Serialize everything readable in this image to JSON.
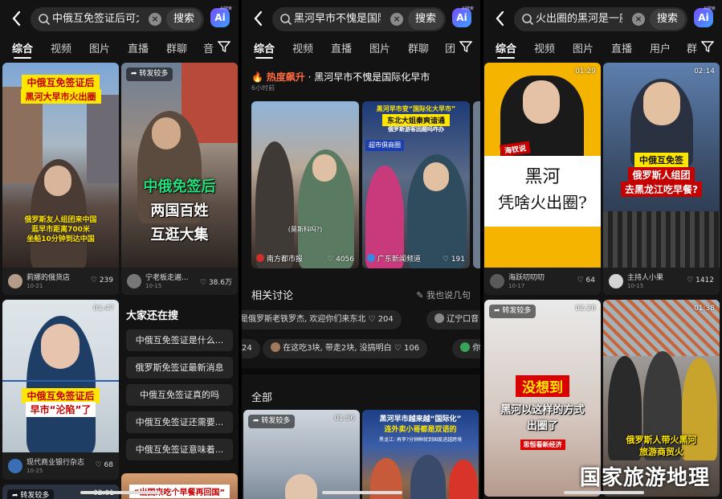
{
  "panels": [
    {
      "query": "中俄互免签证后可太扌",
      "search_label": "搜索",
      "ai_label": "Ai",
      "ai_tag": "AI搜索",
      "tabs": [
        "综合",
        "视频",
        "图片",
        "直播",
        "群聊",
        "音"
      ],
      "cards": [
        {
          "cap1": "中俄互免签证后",
          "cap2": "黑河大早市火出圈",
          "sub": "俄罗斯友人组团来中国\n逛早市距离700米\n坐船10分钟到达中国",
          "author": "莉娜的俄货店",
          "date": "10-21",
          "likes": "239"
        },
        {
          "badge": "转发较多",
          "cap1": "中俄免签后",
          "cap2": "两国百姓",
          "cap3": "互逛大集",
          "author": "宁老板走遍...",
          "date": "10-15",
          "likes": "38.6万"
        },
        {
          "duration": "01:47",
          "cap1": "中俄互免签证后",
          "cap2": "早市“沦陷”了",
          "author": "现代商业银行杂志",
          "date": "10-25",
          "likes": "68"
        },
        {
          "badge": "转发较多",
          "duration": "02:01",
          "cap1": "“出国来吃个早餐再回国”"
        }
      ],
      "also_title": "大家还在搜",
      "suggestions": [
        "中俄互免签证是什么...",
        "俄罗斯免签证最新消息",
        "中俄互免签证真的吗",
        "中俄互免签证还需要...",
        "中俄互免签证意味着..."
      ]
    },
    {
      "query": "黑河早市不愧是国际化",
      "search_label": "搜索",
      "ai_label": "Ai",
      "ai_tag": "AI搜索",
      "tabs": [
        "综合",
        "视频",
        "直播",
        "图片",
        "群聊",
        "团"
      ],
      "hot_label": "热度飙升",
      "hot_title": "· 黑河早市不愧是国际化早市",
      "hot_time": "6小时前",
      "hot_cards": [
        {
          "sub": "(莫斯科吗?)",
          "author": "南方都市报",
          "likes": "4056"
        },
        {
          "cap1": "黑河早市变“国际化大早市”",
          "cap2": "东北大姐秦爽谙通",
          "cap3": "俄罗斯游客因题吗咋办",
          "sign": "超市俱商圈",
          "author": "广东新闻频道",
          "likes": "191"
        }
      ],
      "related_title": "相关讨论",
      "related_right": "我也说几句",
      "chips_row1": [
        {
          "text": "是俄罗斯老铁罗杰, 欢迎你们来东北",
          "likes": "204"
        },
        {
          "text": "辽宁口音"
        }
      ],
      "chips_row2": [
        {
          "text": "24"
        },
        {
          "text": "在这吃3块, 带走2块, 没搞明白",
          "likes": "106"
        },
        {
          "text": "你"
        }
      ],
      "all_title": "全部",
      "bottom_cards": [
        {
          "badge": "转发较多",
          "duration": "01:56"
        },
        {
          "cap1": "黑河早市越来越“国际化”",
          "cap2": "连外卖小哥都是双语的",
          "cap3": "黑龙江: 再李?分钟鲜就到国度进越跨境"
        }
      ]
    },
    {
      "query": "火出圈的黑河是一座",
      "search_label": "搜索",
      "ai_label": "Ai",
      "ai_tag": "AI搜索",
      "tabs": [
        "综合",
        "视频",
        "图片",
        "直播",
        "用户",
        "群"
      ],
      "cards": [
        {
          "duration": "01:29",
          "tag": "海钗说",
          "cap1": "黑河",
          "cap2": "凭啥火出圈?",
          "author": "海跃叨叨叨",
          "date": "10-17",
          "likes": "64"
        },
        {
          "duration": "02:14",
          "cap1": "中俄互免签",
          "cap2": "俄罗斯人组团",
          "cap3": "去黑龙江吃早餐?",
          "author": "主持人小果",
          "date": "10-15",
          "likes": "1412"
        },
        {
          "badge": "转发较多",
          "duration": "02:26",
          "cap1": "没想到",
          "cap2": "黑河以这样的方式",
          "cap3": "出圈了",
          "cap4": "思恒看新经济"
        },
        {
          "duration": "01:38",
          "cap1": "俄罗斯人带火黑河",
          "cap2": "旅游商贸火"
        }
      ]
    }
  ],
  "watermark": "国家旅游地理",
  "colors": {
    "panel": "#131313",
    "hot": "#ff6a3d",
    "caption_yellow": "#ffe600",
    "caption_red": "#c40000"
  }
}
